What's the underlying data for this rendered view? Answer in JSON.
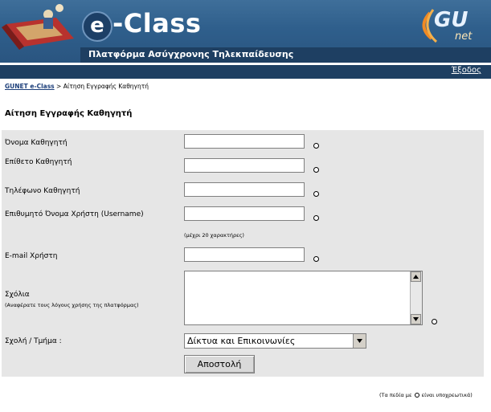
{
  "header": {
    "logo_letter": "e",
    "logo_text": "-Class",
    "subtitle": "Πλατφόρμα Ασύγχρονης Τηλεκπαίδευσης",
    "partner_gu": "GU",
    "partner_net": "net"
  },
  "nav": {
    "logout": "Έξοδος"
  },
  "breadcrumb": {
    "home": "GUNET e-Class",
    "separator": " > ",
    "current": "Αίτηση Εγγραφής Καθηγητή"
  },
  "page_title": "Αίτηση Εγγραφής Καθηγητή",
  "form": {
    "first_name_label": "Όνομα Καθηγητή",
    "last_name_label": "Επίθετο Καθηγητή",
    "phone_label": "Τηλέφωνο Καθηγητή",
    "username_label": "Επιθυμητό Όνομα Χρήστη (Username)",
    "username_hint": "(μέχρι 20 χαρακτήρες)",
    "email_label": "E-mail Χρήστη",
    "comments_label": "Σχόλια",
    "comments_hint": "(Αναφέρατε τους λόγους χρήσης της πλατφόρμας)",
    "department_label": "Σχολή / Τμήμα :",
    "department_value": "Δίκτυα και Επικοινωνίες",
    "submit_label": "Αποστολή"
  },
  "footnote": {
    "before": "(Τα πεδία με",
    "after": "είναι υποχρεωτικά)"
  }
}
